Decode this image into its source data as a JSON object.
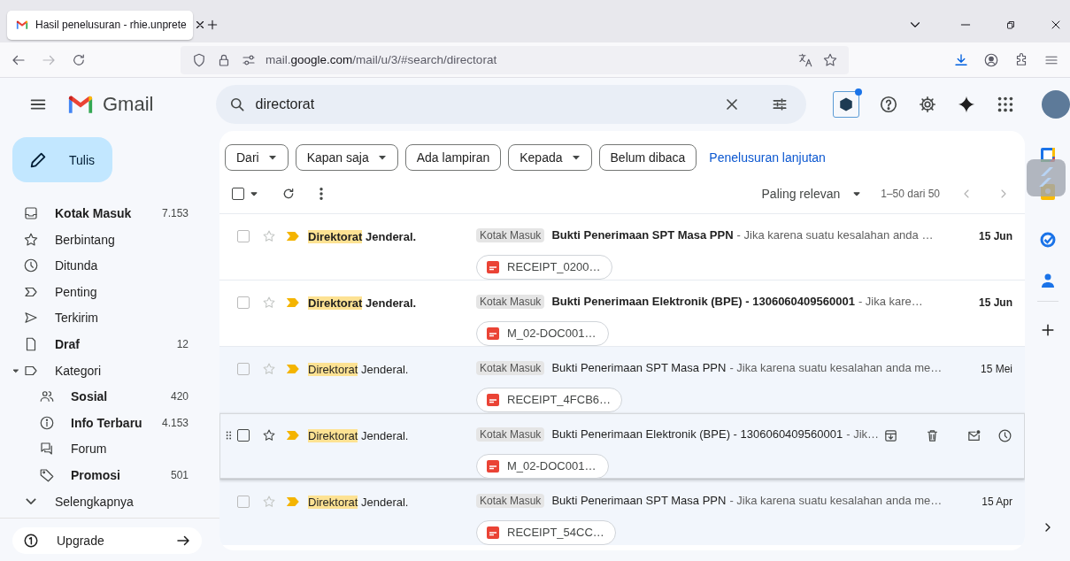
{
  "browser": {
    "tab": {
      "title": "Hasil penelusuran - rhie.unprete"
    },
    "url": "mail.**google.com**/mail/u/3/#search/directorat"
  },
  "app": {
    "name": "Gmail"
  },
  "search": {
    "value": "directorat"
  },
  "compose": {
    "label": "Tulis"
  },
  "sidebar": {
    "items": [
      {
        "label": "Kotak Masuk",
        "count": "7.153",
        "unread": true,
        "selected": false
      },
      {
        "label": "Berbintang",
        "unread": false,
        "selected": false
      },
      {
        "label": "Ditunda",
        "unread": false,
        "selected": false
      },
      {
        "label": "Penting",
        "unread": false,
        "selected": false
      },
      {
        "label": "Terkirim",
        "unread": false,
        "selected": false
      },
      {
        "label": "Draf",
        "count": "12",
        "unread": true,
        "selected": false
      },
      {
        "label": "Kategori",
        "unread": false,
        "selected": false,
        "expanded": true,
        "children": [
          {
            "label": "Sosial",
            "count": "420",
            "unread": true,
            "selected": false
          },
          {
            "label": "Info Terbaru",
            "count": "4.153",
            "unread": true,
            "selected": false
          },
          {
            "label": "Forum",
            "unread": false,
            "selected": false
          },
          {
            "label": "Promosi",
            "count": "501",
            "unread": true,
            "selected": false
          }
        ]
      }
    ],
    "more": {
      "label": "Selengkapnya"
    }
  },
  "upgrade": {
    "label": "Upgrade"
  },
  "filters": [
    {
      "label": "Dari",
      "kind": "dropdown"
    },
    {
      "label": "Kapan saja",
      "kind": "dropdown"
    },
    {
      "label": "Ada lampiran",
      "kind": "toggle"
    },
    {
      "label": "Kepada",
      "kind": "dropdown"
    },
    {
      "label": "Belum dibaca",
      "kind": "toggle"
    }
  ],
  "advanced_search": "Penelusuran lanjutan",
  "toolbar": {
    "select_all_checked": false,
    "sort": "Paling relevan",
    "range": "1–50 dari 50"
  },
  "rows": [
    {
      "checked": false,
      "starred": false,
      "important": true,
      "unread": true,
      "hovered": false,
      "sender_match": "Direktorat",
      "sender_rest": "Jenderal.",
      "label": "Kotak Masuk",
      "subject": "Bukti Penerimaan SPT Masa PPN",
      "snippet": "- Jika karena suatu kesalahan anda …",
      "attachment": "RECEIPT_0200…",
      "date": "15 Jun"
    },
    {
      "checked": false,
      "starred": false,
      "important": true,
      "unread": true,
      "hovered": false,
      "sender_match": "Direktorat",
      "sender_rest": "Jenderal.",
      "label": "Kotak Masuk",
      "subject": "Bukti Penerimaan Elektronik (BPE) - 1306060409560001",
      "snippet": "- Jika kare…",
      "attachment": "M_02-DOC001…",
      "date": "15 Jun"
    },
    {
      "checked": false,
      "starred": false,
      "important": true,
      "unread": false,
      "hovered": false,
      "sender_match": "Direktorat",
      "sender_rest": "Jenderal.",
      "label": "Kotak Masuk",
      "subject": "Bukti Penerimaan SPT Masa PPN",
      "snippet": "- Jika karena suatu kesalahan anda me…",
      "attachment": "RECEIPT_4FCB6…",
      "date": "15 Mei"
    },
    {
      "checked": false,
      "starred": false,
      "important": true,
      "unread": false,
      "hovered": true,
      "sender_match": "Direktorat",
      "sender_rest": "Jenderal.",
      "label": "Kotak Masuk",
      "subject": "Bukti Penerimaan Elektronik (BPE) - 1306060409560001",
      "snippet": "- Jik…",
      "attachment": "M_02-DOC001…"
    },
    {
      "checked": false,
      "starred": false,
      "important": true,
      "unread": false,
      "hovered": false,
      "sender_match": "Direktorat",
      "sender_rest": "Jenderal.",
      "label": "Kotak Masuk",
      "subject": "Bukti Penerimaan SPT Masa PPN",
      "snippet": "- Jika karena suatu kesalahan anda me…",
      "attachment": "RECEIPT_54CC…",
      "date": "15 Apr"
    }
  ]
}
